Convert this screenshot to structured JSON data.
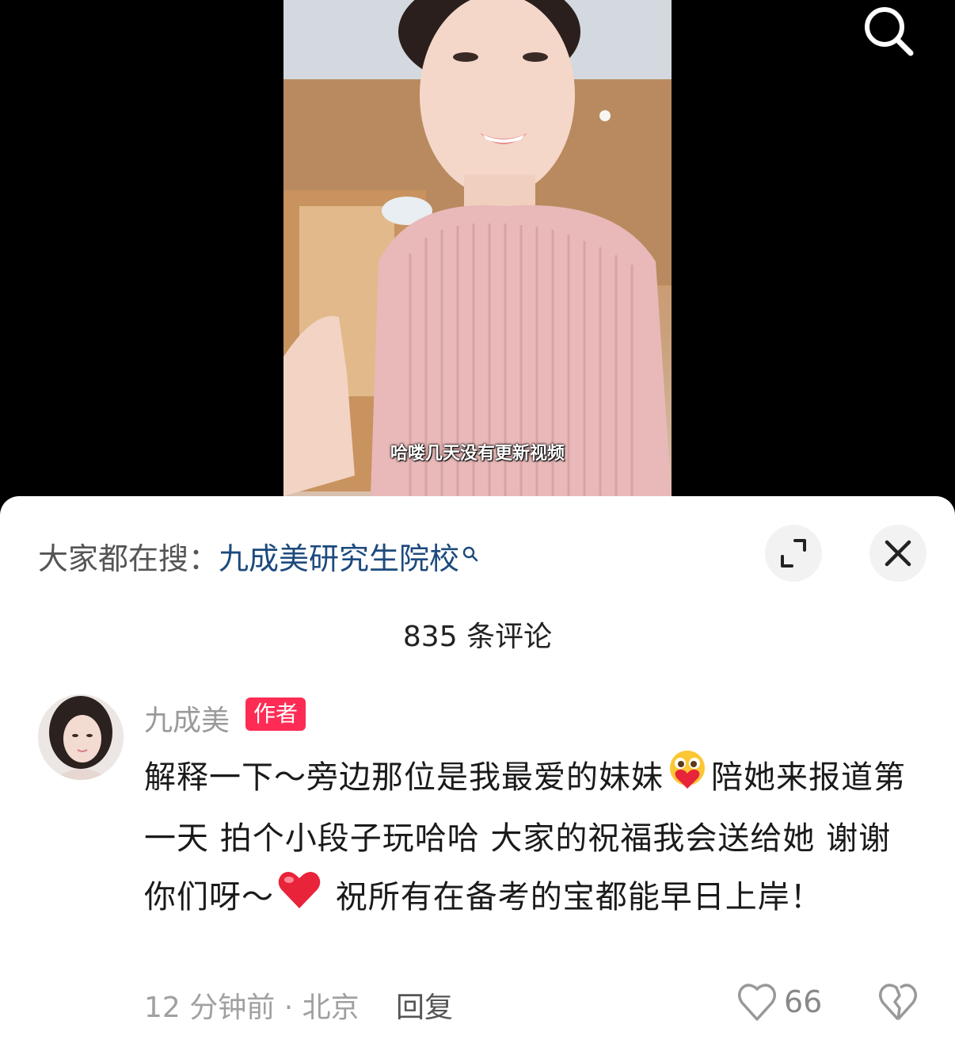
{
  "video": {
    "subtitle": "哈喽几天没有更新视频",
    "search_icon": "search-icon"
  },
  "comments_panel": {
    "hot_search_prefix": "大家都在搜：",
    "hot_search_term": "九成美研究生院校",
    "expand_icon": "expand-icon",
    "close_icon": "close-icon",
    "comment_count": "835 条评论"
  },
  "comment": {
    "author": "九成美",
    "author_badge": "作者",
    "text_part1": "解释一下～旁边那位是我最爱的妹妹",
    "text_part2": "陪她来报道第一天 拍个小段子玩哈哈 大家的祝福我会送给她 谢谢你们呀～",
    "text_part3": " 祝所有在备考的宝都能早日上岸！",
    "time_location": "12 分钟前 · 北京",
    "reply_label": "回复",
    "like_count": "66",
    "colors": {
      "badge": "#fe2c55",
      "hot_search": "#1d4a7d"
    }
  }
}
